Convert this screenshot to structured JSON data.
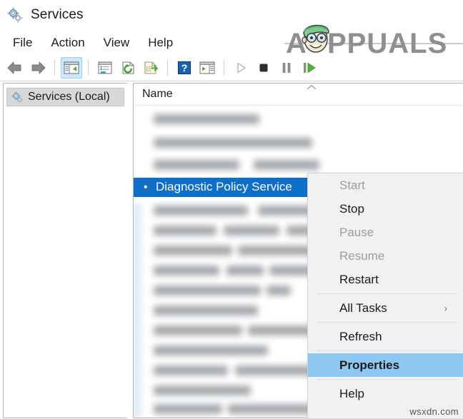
{
  "window": {
    "title": "Services",
    "icon": "gears-icon"
  },
  "menubar": {
    "items": [
      {
        "label": "File",
        "name": "menu-file"
      },
      {
        "label": "Action",
        "name": "menu-action"
      },
      {
        "label": "View",
        "name": "menu-view"
      },
      {
        "label": "Help",
        "name": "menu-help"
      }
    ]
  },
  "toolbar": {
    "buttons": [
      {
        "icon": "back-arrow-icon",
        "name": "toolbar-back",
        "state": "enabled"
      },
      {
        "icon": "forward-arrow-icon",
        "name": "toolbar-forward",
        "state": "enabled"
      },
      {
        "icon": "show-hide-console-tree-icon",
        "name": "toolbar-show-tree",
        "state": "active"
      },
      {
        "icon": "properties-icon",
        "name": "toolbar-properties",
        "state": "enabled"
      },
      {
        "icon": "refresh-icon",
        "name": "toolbar-refresh",
        "state": "enabled"
      },
      {
        "icon": "export-list-icon",
        "name": "toolbar-export-list",
        "state": "enabled"
      },
      {
        "icon": "help-question-icon",
        "name": "toolbar-help",
        "state": "enabled"
      },
      {
        "icon": "show-action-pane-icon",
        "name": "toolbar-action-pane",
        "state": "enabled"
      },
      {
        "icon": "start-service-icon",
        "name": "toolbar-start-service",
        "state": "disabled"
      },
      {
        "icon": "stop-service-icon",
        "name": "toolbar-stop-service",
        "state": "enabled"
      },
      {
        "icon": "pause-service-icon",
        "name": "toolbar-pause-service",
        "state": "enabled"
      },
      {
        "icon": "restart-service-icon",
        "name": "toolbar-restart-service",
        "state": "enabled"
      }
    ]
  },
  "sidebar": {
    "node": {
      "label": "Services (Local)",
      "icon": "gears-icon",
      "selected": true
    }
  },
  "list": {
    "column_header": "Name",
    "sort_indicator": "ascending-chevron-icon",
    "selected_row": {
      "label": "Diagnostic Policy Service",
      "icon": "service-gear-icon"
    },
    "blurred_rows_above": 4,
    "blurred_rows_below": 10
  },
  "context_menu": {
    "items": [
      {
        "label": "Start",
        "name": "context-menu-start",
        "state": "disabled",
        "separator_after": false
      },
      {
        "label": "Stop",
        "name": "context-menu-stop",
        "state": "enabled",
        "separator_after": false
      },
      {
        "label": "Pause",
        "name": "context-menu-pause",
        "state": "disabled",
        "separator_after": false
      },
      {
        "label": "Resume",
        "name": "context-menu-resume",
        "state": "disabled",
        "separator_after": false
      },
      {
        "label": "Restart",
        "name": "context-menu-restart",
        "state": "enabled",
        "separator_after": true
      },
      {
        "label": "All Tasks",
        "name": "context-menu-all-tasks",
        "state": "enabled",
        "submenu": true,
        "submenu_arrow": "chevron-right-icon",
        "separator_after": true
      },
      {
        "label": "Refresh",
        "name": "context-menu-refresh",
        "state": "enabled",
        "separator_after": true
      },
      {
        "label": "Properties",
        "name": "context-menu-properties",
        "state": "highlighted",
        "separator_after": true
      },
      {
        "label": "Help",
        "name": "context-menu-help",
        "state": "enabled",
        "separator_after": false
      }
    ]
  },
  "watermarks": {
    "brand": "APPUALS",
    "site": "wsxdn.com"
  },
  "colors": {
    "selection_blue": "#0d6fc8",
    "menu_highlight": "#8ec7f2",
    "toolbar_active": "#cce8ff",
    "disabled_text": "#9d9d9d",
    "panel_border": "#b4b4b4",
    "menu_background": "#f1f1f1"
  }
}
